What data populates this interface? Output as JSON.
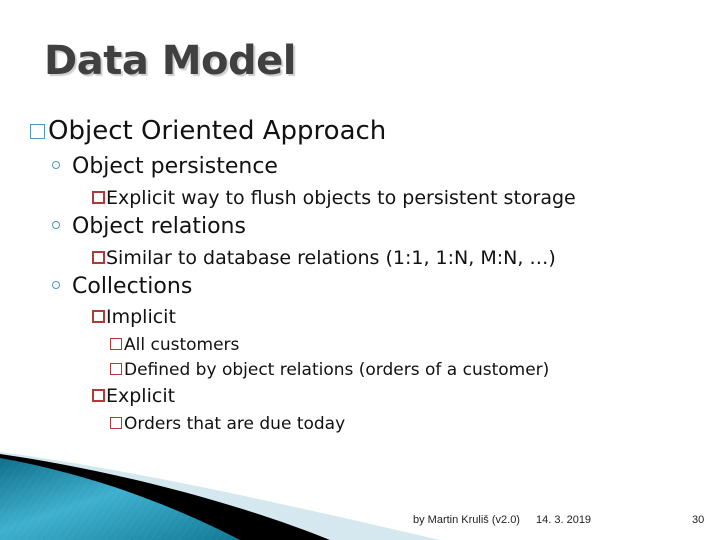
{
  "slide": {
    "title": "Data Model",
    "bullets": [
      {
        "level": 1,
        "text": "Object Oriented Approach"
      },
      {
        "level": 2,
        "text": "Object persistence"
      },
      {
        "level": 3,
        "text": "Explicit way to flush objects to persistent storage"
      },
      {
        "level": 2,
        "text": "Object relations"
      },
      {
        "level": 3,
        "text": "Similar to database relations (1:1, 1:N, M:N, …)"
      },
      {
        "level": 2,
        "text": "Collections"
      },
      {
        "level": 3,
        "text": "Implicit"
      },
      {
        "level": 4,
        "text": "All customers"
      },
      {
        "level": 4,
        "text": "Defined by object relations (orders of a customer)"
      },
      {
        "level": 3,
        "text": "Explicit"
      },
      {
        "level": 4,
        "text": "Orders that are due today"
      }
    ]
  },
  "footer": {
    "author": "by Martin Kruliš (v2.0)",
    "date": "14. 3. 2019",
    "page_number": "30"
  },
  "colors": {
    "accent_teal": "#1a8aa8",
    "bullet_red": "#b03a3a",
    "title_gray": "#404040"
  }
}
